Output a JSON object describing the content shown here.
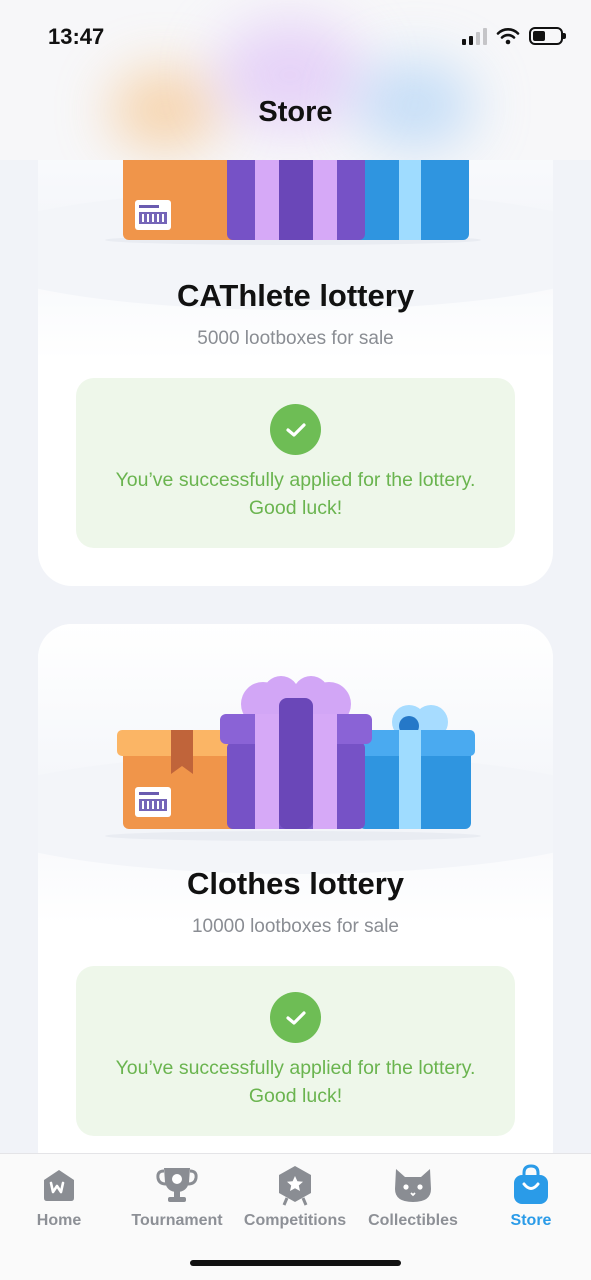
{
  "status_bar": {
    "time": "13:47"
  },
  "header": {
    "title": "Store"
  },
  "lotteries": [
    {
      "title": "CAThlete lottery",
      "subtitle": "5000 lootboxes for sale",
      "status_text": "You’ve successfully applied for the lottery. Good luck!"
    },
    {
      "title": "Clothes lottery",
      "subtitle": "10000 lootboxes for sale",
      "status_text": "You’ve successfully applied for the lottery. Good luck!"
    }
  ],
  "tabbar": {
    "items": [
      {
        "label": "Home",
        "icon": "home-w-icon"
      },
      {
        "label": "Tournament",
        "icon": "trophy-icon"
      },
      {
        "label": "Competitions",
        "icon": "hexagon-star-icon"
      },
      {
        "label": "Collectibles",
        "icon": "cat-icon"
      },
      {
        "label": "Store",
        "icon": "shopping-bag-icon"
      }
    ],
    "active": "Store"
  },
  "colors": {
    "accent": "#2a9be8",
    "success_bg": "#eef7ea",
    "success_text": "#6ab44f",
    "check": "#6ebd55",
    "box_orange": "#f0954a",
    "box_purple": "#7a55c8",
    "box_blue": "#2f95e0"
  }
}
